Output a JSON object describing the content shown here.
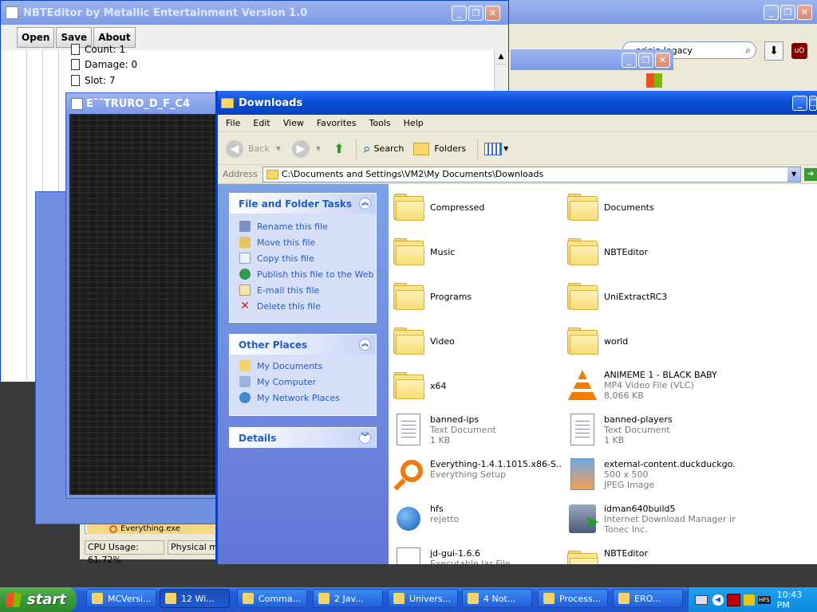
{
  "nbt": {
    "title": "NBTEditor by Metallic Entertainment Version 1.0",
    "buttons": [
      "Open",
      "Save",
      "About"
    ],
    "tree": [
      "Count: 1",
      "Damage: 0",
      "Slot: 7"
    ]
  },
  "browser": {
    "search_text": "origin legacy"
  },
  "mc_window": {
    "title": "EˉˉTRURO_D_F_C4"
  },
  "explorer": {
    "title": "Downloads",
    "menu": [
      "File",
      "Edit",
      "View",
      "Favorites",
      "Tools",
      "Help"
    ],
    "toolbar": {
      "back": "Back",
      "search": "Search",
      "folders": "Folders"
    },
    "address_label": "Address",
    "address_value": "C:\\Documents and Settings\\VM2\\My Documents\\Downloads",
    "tasks": {
      "title": "File and Folder Tasks",
      "items": [
        "Rename this file",
        "Move this file",
        "Copy this file",
        "Publish this file to the Web",
        "E-mail this file",
        "Delete this file"
      ]
    },
    "places": {
      "title": "Other Places",
      "items": [
        "My Documents",
        "My Computer",
        "My Network Places"
      ]
    },
    "details": {
      "title": "Details"
    },
    "files": [
      {
        "name": "Compressed",
        "kind": "folder"
      },
      {
        "name": "Documents",
        "kind": "folder"
      },
      {
        "name": "Music",
        "kind": "folder"
      },
      {
        "name": "NBTEditor",
        "kind": "folder"
      },
      {
        "name": "Programs",
        "kind": "folder"
      },
      {
        "name": "UniExtractRC3",
        "kind": "folder"
      },
      {
        "name": "Video",
        "kind": "folder"
      },
      {
        "name": "world",
        "kind": "folder"
      },
      {
        "name": "x64",
        "kind": "folder"
      },
      {
        "name": "ANIMEME 1 - BLACK BABY",
        "line2": "MP4 Video File (VLC)",
        "line3": "8,066 KB",
        "kind": "vlc"
      },
      {
        "name": "banned-ips",
        "line2": "Text Document",
        "line3": "1 KB",
        "kind": "text"
      },
      {
        "name": "banned-players",
        "line2": "Text Document",
        "line3": "1 KB",
        "kind": "text"
      },
      {
        "name": "Everything-1.4.1.1015.x86-S...",
        "line2": "Everything Setup",
        "line3": "",
        "kind": "everything"
      },
      {
        "name": "external-content.duckduckgo....",
        "line2": "500 x 500",
        "line3": "JPEG Image",
        "kind": "jpeg"
      },
      {
        "name": "hfs",
        "line2": "rejetto",
        "line3": "",
        "kind": "hfs"
      },
      {
        "name": "idman640build5",
        "line2": "Internet Download Manager in...",
        "line3": "Tonec Inc.",
        "kind": "idm"
      },
      {
        "name": "jd-gui-1.6.6",
        "line2": "Executable Jar File",
        "line3": "",
        "kind": "jar"
      },
      {
        "name": "NBTEditor",
        "line2": "",
        "line3": "",
        "kind": "zipfolder"
      }
    ]
  },
  "task_manager": {
    "cpu": "CPU Usage: 61.72%",
    "mem": "Physical me",
    "list_item": "Everything.exe"
  },
  "taskbar": {
    "start": "start",
    "buttons": [
      "MCVersi...",
      "12 Wi...",
      "Comma...",
      "2 Jav...",
      "Univers...",
      "4 Not...",
      "Process...",
      "ERO..."
    ],
    "clock": "10:43 PM",
    "hfs_label": "HFS"
  },
  "colors": {
    "xp_blue": "#0a4fd6",
    "taskbar": "#245edb",
    "start_green": "#3c9a3c",
    "panel_bg": "#7a96df",
    "link": "#215dc6"
  }
}
